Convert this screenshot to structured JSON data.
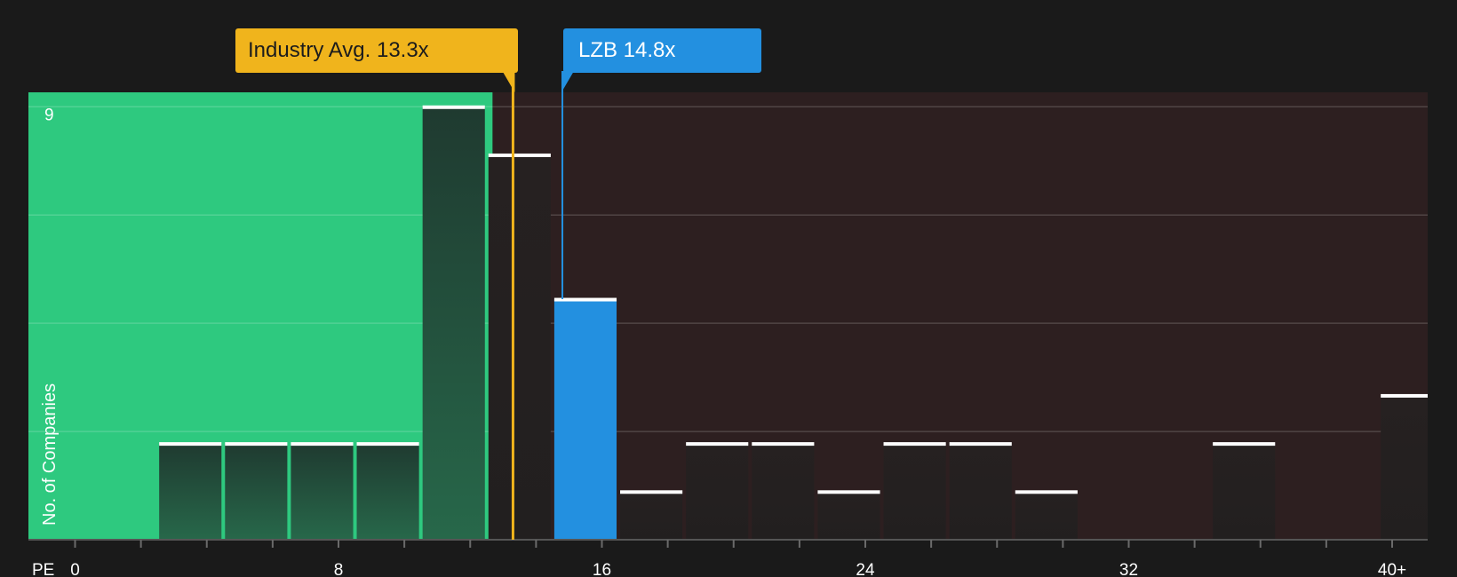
{
  "chart_data": {
    "type": "bar",
    "xlabel": "PE",
    "ylabel": "No. of Companies",
    "x_tick_labels": [
      "0",
      "8",
      "16",
      "24",
      "32",
      "40+"
    ],
    "x_tick_values": [
      0,
      8,
      16,
      24,
      32,
      40
    ],
    "xlim": [
      -1.4,
      41.1
    ],
    "ylim": [
      0,
      9.3
    ],
    "y_tick_labels": [
      {
        "value": 9,
        "label": "9"
      }
    ],
    "gridlines_y": [
      2.25,
      4.5,
      6.75,
      9
    ],
    "bin_width": 2,
    "bars": [
      {
        "x": 3.5,
        "value": 2
      },
      {
        "x": 5.5,
        "value": 2
      },
      {
        "x": 7.5,
        "value": 2
      },
      {
        "x": 9.5,
        "value": 2
      },
      {
        "x": 11.5,
        "value": 9
      },
      {
        "x": 13.5,
        "value": 8
      },
      {
        "x": 15.5,
        "value": 5,
        "highlight": true
      },
      {
        "x": 17.5,
        "value": 1
      },
      {
        "x": 19.5,
        "value": 2
      },
      {
        "x": 21.5,
        "value": 2
      },
      {
        "x": 23.5,
        "value": 1
      },
      {
        "x": 25.5,
        "value": 2
      },
      {
        "x": 27.5,
        "value": 2
      },
      {
        "x": 29.5,
        "value": 1
      },
      {
        "x": 35.5,
        "value": 2
      },
      {
        "x": 40.6,
        "value": 3
      }
    ],
    "industry_average": {
      "label": "Industry Avg. 13.3x",
      "value": 13.3
    },
    "company": {
      "label": "LZB 14.8x",
      "value": 14.8
    },
    "colors": {
      "undervalued_zone": "#2ec97f",
      "overvalued_zone": "#2d1f20",
      "industry": "#f0b41c",
      "company": "#2390e0",
      "bar_top": "#ffffff"
    }
  }
}
